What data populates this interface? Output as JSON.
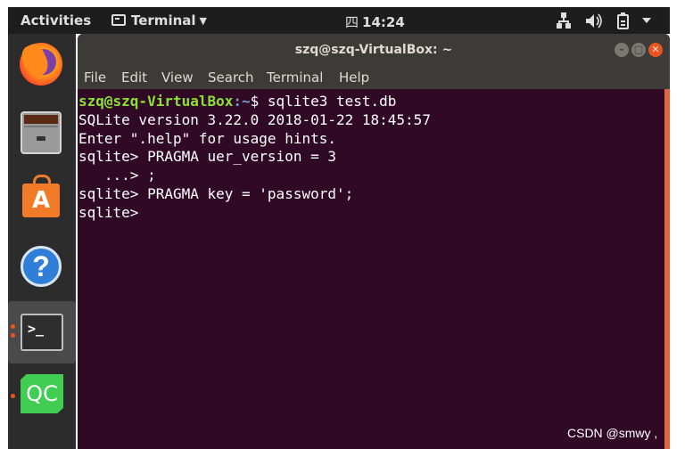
{
  "topbar": {
    "activities": "Activities",
    "app_menu": "Terminal",
    "clock_day": "四",
    "clock_time": "14:24",
    "tray_icons": [
      "network-icon",
      "volume-icon",
      "battery-icon",
      "power-menu-icon"
    ]
  },
  "dock": {
    "items": [
      "firefox",
      "files",
      "ubuntu-software",
      "help",
      "terminal",
      "qt-creator"
    ],
    "store_glyph": "A",
    "help_glyph": "?",
    "terminal_glyph": ">_",
    "qc_label": "QC"
  },
  "window": {
    "title": "szq@szq-VirtualBox: ~",
    "menu": [
      "File",
      "Edit",
      "View",
      "Search",
      "Terminal",
      "Help"
    ]
  },
  "terminal": {
    "prompt_user": "szq@szq-VirtualBox",
    "prompt_path": ":~",
    "prompt_symbol": "$ ",
    "command": "sqlite3 test.db",
    "lines": [
      "SQLite version 3.22.0 2018-01-22 18:45:57",
      "Enter \".help\" for usage hints.",
      "sqlite> PRAGMA uer_version = 3",
      "   ...> ;",
      "sqlite> PRAGMA key = 'password';",
      "sqlite> "
    ]
  },
  "watermark": "CSDN @smwy ,",
  "colors": {
    "terminal_bg": "#300a24",
    "prompt_user": "#8ae234",
    "prompt_path": "#729fcf",
    "accent": "#e95420"
  }
}
